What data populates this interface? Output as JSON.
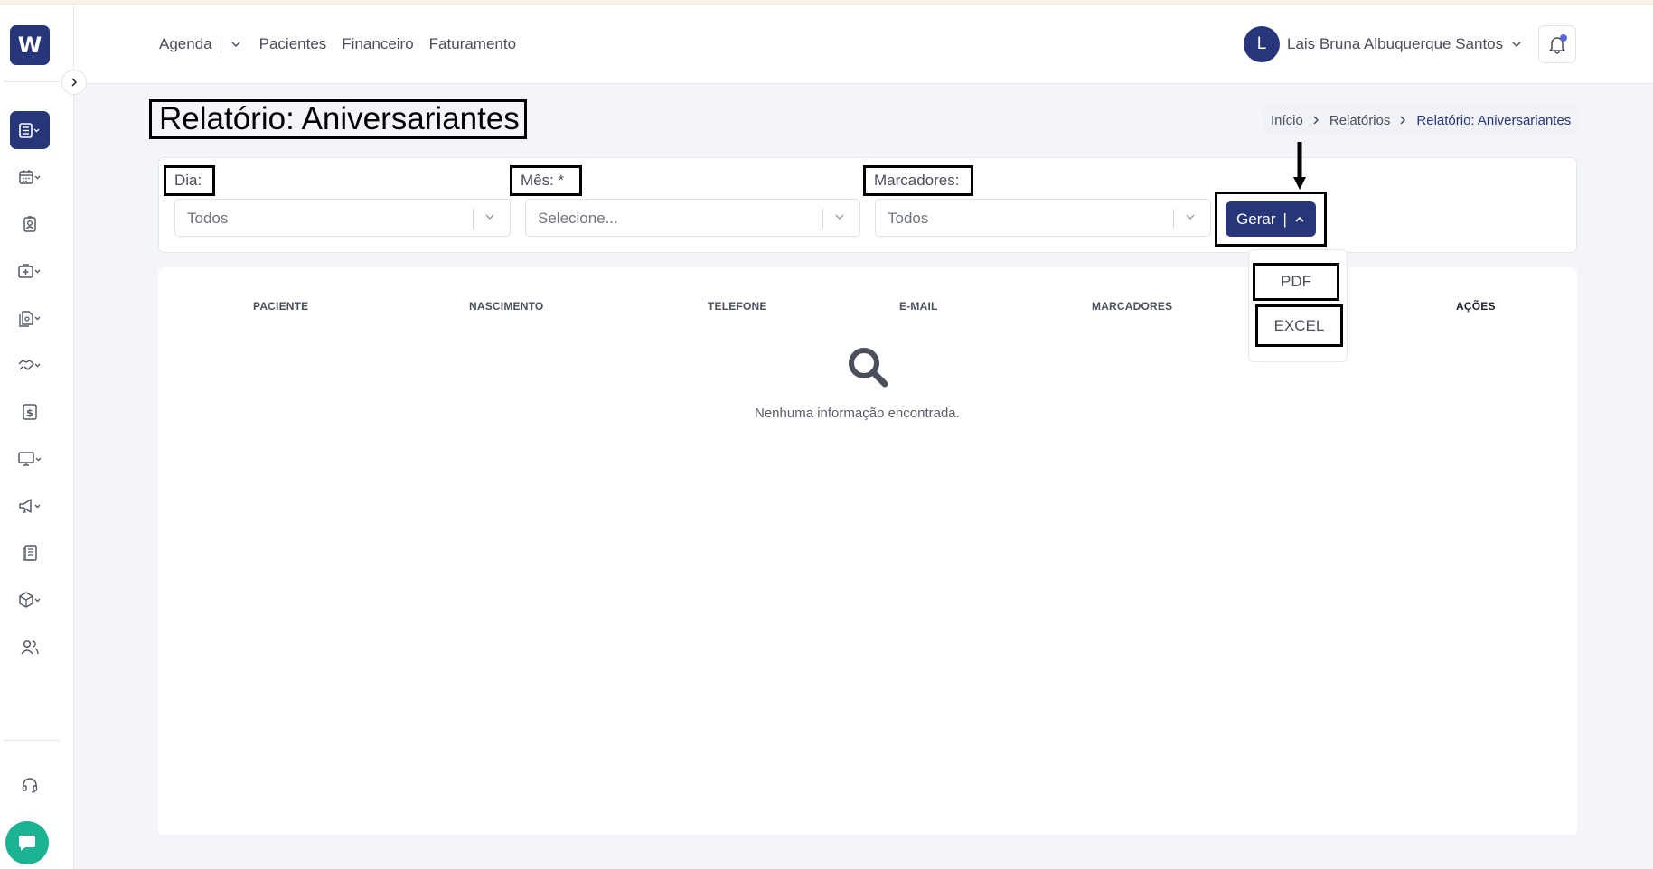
{
  "app": {
    "logo_text": "W",
    "accent_color": "#27357a",
    "chat_color": "#1bb394"
  },
  "topnav": {
    "items": [
      "Agenda",
      "Pacientes",
      "Financeiro",
      "Faturamento"
    ]
  },
  "user": {
    "avatar_initial": "L",
    "name": "Lais Bruna Albuquerque Santos"
  },
  "page": {
    "title": "Relatório: Aniversariantes"
  },
  "breadcrumb": {
    "items": [
      "Início",
      "Relatórios",
      "Relatório: Aniversariantes"
    ]
  },
  "filters": {
    "dia": {
      "label": "Dia:",
      "value": "Todos"
    },
    "mes": {
      "label": "Mês: *",
      "placeholder": "Selecione..."
    },
    "marcadores": {
      "label": "Marcadores:",
      "value": "Todos"
    },
    "gerar_label": "Gerar",
    "gerar_pipe": "|"
  },
  "export_menu": {
    "items": [
      "PDF",
      "EXCEL"
    ]
  },
  "table": {
    "headers": [
      "PACIENTE",
      "NASCIMENTO",
      "TELEFONE",
      "E-MAIL",
      "MARCADORES",
      "AÇÕES"
    ],
    "empty_message": "Nenhuma informação encontrada."
  },
  "sidebar": {
    "icons": [
      "contacts-book-icon",
      "calendar-icon",
      "patient-card-icon",
      "medical-kit-icon",
      "documents-icon",
      "handshake-icon",
      "dollar-icon",
      "monitor-icon",
      "megaphone-icon",
      "report-icon",
      "box-icon",
      "users-icon",
      "headset-icon",
      "chat-icon"
    ]
  }
}
